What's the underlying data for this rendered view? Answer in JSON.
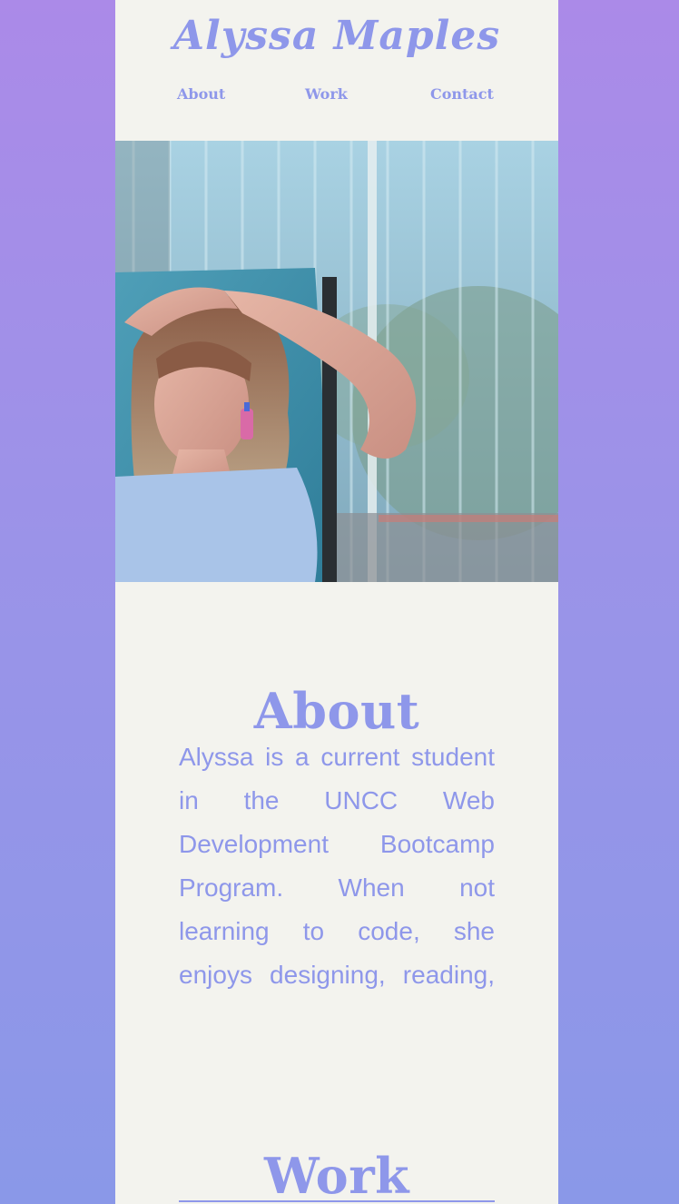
{
  "header": {
    "title": "Alyssa Maples",
    "nav": {
      "about": "About",
      "work": "Work",
      "contact": "Contact"
    }
  },
  "hero": {
    "alt": "Photo of Alyssa reclining in a blue lawn chair by a window"
  },
  "about": {
    "heading": "About",
    "body": "Alyssa is a current student in the UNCC Web Development Bootcamp Program. When not learning to code, she enjoys designing, reading, and playing with her cats."
  },
  "work": {
    "heading": "Work"
  },
  "colors": {
    "accent": "#8e97ea",
    "panel": "#f3f3ee",
    "gradient_top": "#ab8ae8",
    "gradient_bottom": "#8a98e8"
  }
}
